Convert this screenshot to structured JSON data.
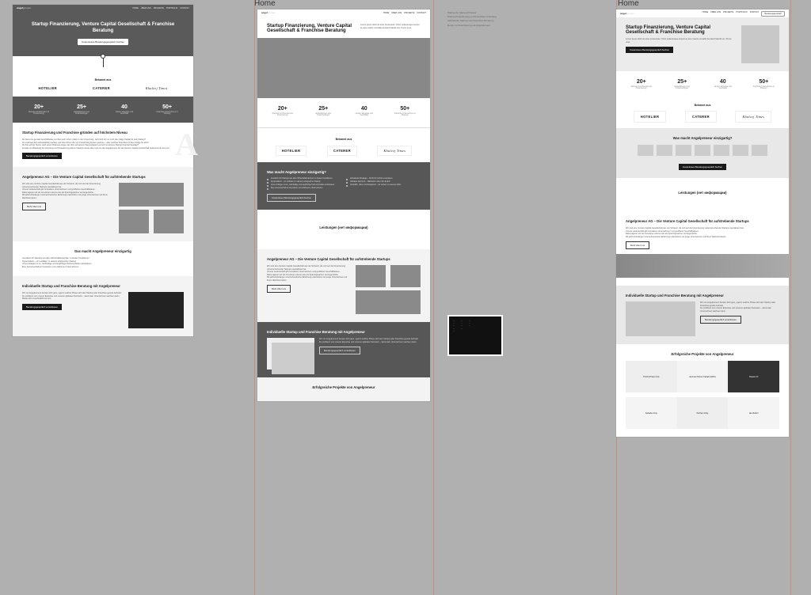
{
  "labels": {
    "home1": "Home",
    "home2": "Home"
  },
  "brand": {
    "strong": "angel",
    "light": "preneur"
  },
  "nav": [
    "HOME",
    "ÜBER UNS",
    "PROJEKTE",
    "PORTFOLIO",
    "KONTAKT"
  ],
  "nav_cta": "Beratungsgespräch",
  "hero": {
    "title": "Startup Finanzierung, Venture Capital Gesellschaft & Franchise Beratung",
    "cta": "Kostenloses Beratungsgespräch buchen",
    "sub_small": "Lorem ipsum dolor sit amet consectetur. Tortor pellentesque tempor ac arcu mauris convallis hendrerit blandit non. Purus urna."
  },
  "bekannt": {
    "title": "Bekannt aus",
    "brands": [
      "HOTELIER",
      "CATERER",
      "Khaleej Times"
    ]
  },
  "stats": [
    {
      "n": "20+",
      "l": "Startups mit Potential und Finanzierung"
    },
    {
      "n": "25+",
      "l": "Entwicklungen und Finanzierungen"
    },
    {
      "n": "40",
      "l": "Länder, Expertise und Geschäfts"
    },
    {
      "n": "50+",
      "l": "Franchise Unternehmen in Planung"
    }
  ],
  "intro": {
    "title": "Startup Finanzierung und Franchise gründen auf höchstem Niveau",
    "p1": "Du hast eine geniale Geschäftsidee und bist auch schon mitten in der Umsetzung. Jetzt fehlt dir nur noch das nötige Kapital für dein Startup?",
    "p2": "Du möchtest dich selbstständig machen und hast schon über ein Franchising System gelesen – aber welches Franchise ist das richtige für dich?",
    "p3": "Du bist auf der Suche nach einem Business Angel, der dich auf deinem Weg begleitet und sich an deinem Startup finanziell beteiligt?",
    "p4": "Kontakt und Beratung für Gründung und Finanzierung deines Startups sowie alles rund um die Angelpreneur AG als Venture Capital Gesellschaft bekommst du bei uns!",
    "cta": "Beratungsgespräch vereinbaren"
  },
  "vc": {
    "title": "Angelpreneur AG – Die Venture Capital Gesellschaft für aufstrebende Startups",
    "p1": "Wir sind eine Venture Capital Gesellschaft aus der Schweiz, die sich auf die Finanzierung vielversprechender Startups spezialisiert hat.",
    "p2": "Unsere Leidenschaft gilt innovativen Unternehmern und greifbaren Geschäftsideen.",
    "p3": "Dabei agieren wir als Investoren ebenso wie als Sparringspartner auf Augenhöhe.",
    "p4": "Mit jahrzehntelanger unternehmerischer Erfahrung unterstützen wir junge Unternehmen auf ihrem Wachstumskurs.",
    "cta": "Mehr über uns"
  },
  "unique": {
    "title_a": "Das macht Angelpreneur einzigartig",
    "title_b": "Was macht Angelpreneur einzigartig?",
    "bullets": [
      "Investition für Startups aus allen Wirtschaftsbranchen zu besten Konditionen",
      "Systematisch – ein Leitfaden zu deinem erfolgreichen Startup",
      "Unser Anliegen ist es, nachhaltige und langfristige Partnerschaften aufzubauen",
      "Eine Gemeinschaft an Investoren und erfahrenen Unternehmern",
      "Individuelle Strategie – Schritt für Schritt vereinbaren",
      "Globales Netzwerk – Wahrheit in über 40 Ländern",
      "Gründlich, offen und transparent – wir stehen zu unserem Wort"
    ],
    "cta": "Kostenloses Beratungsgespräch buchen"
  },
  "leistungen": {
    "title": "Leistungen (нет информации)"
  },
  "consult": {
    "title": "Individuelle Startup und Franchise Beratung mit Angelpreneur",
    "p1": "Wir von Angelpreneur beraten dich gern, egal in welcher Phase sich dein Startup oder Franchise gerade befindet.",
    "p2": "Du profitierst von unserer Expertise und unserem globalen Netzwerk – damit dein Unternehmen wachsen kann.",
    "p3": "Melde dich unverbindlich bei uns.",
    "cta": "Beratungsgespräch vereinbaren"
  },
  "erfolg": {
    "title": "Erfolgreiche Projekte von Angelpreneur",
    "projects": [
      {
        "name": "Prizzl (Prison Art)"
      },
      {
        "name": "German Doner Kebab (GDK)"
      },
      {
        "name": "Sweet.Ch"
      },
      {
        "name": "Kebabs Only"
      },
      {
        "name": "Kitchen Only"
      },
      {
        "name": "LE HUGO"
      }
    ]
  },
  "meta_side": [
    "Startup für Startup Prozess",
    "Startup Finanzierung und Franchise Gründung",
    "Individuelle Startup und Franchise Beratung",
    "Rund-um Finanzierung mit Angelpreneur"
  ]
}
